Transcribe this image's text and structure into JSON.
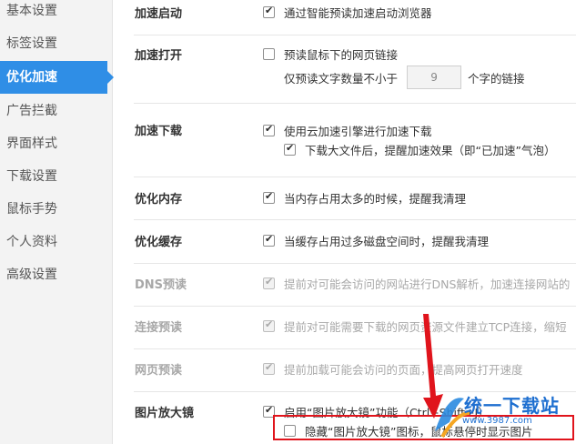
{
  "sidebar": {
    "items": [
      {
        "label": "基本设置",
        "active": false
      },
      {
        "label": "标签设置",
        "active": false
      },
      {
        "label": "优化加速",
        "active": true
      },
      {
        "label": "广告拦截",
        "active": false
      },
      {
        "label": "界面样式",
        "active": false
      },
      {
        "label": "下载设置",
        "active": false
      },
      {
        "label": "鼠标手势",
        "active": false
      },
      {
        "label": "个人资料",
        "active": false
      },
      {
        "label": "高级设置",
        "active": false
      }
    ]
  },
  "sections": {
    "accel_start": {
      "label": "加速启动",
      "option": {
        "text": "通过智能预读加速启动浏览器",
        "checked": true
      }
    },
    "accel_open": {
      "label": "加速打开",
      "option": {
        "text": "预读鼠标下的网页链接",
        "checked": false
      },
      "sub": {
        "prefix": "仅预读文字数量不小于",
        "value": "9",
        "suffix": "个字的链接"
      }
    },
    "accel_download": {
      "label": "加速下载",
      "option": {
        "text": "使用云加速引擎进行加速下载",
        "checked": true
      },
      "sub_option": {
        "text": "下载大文件后，提醒加速效果（即“已加速”气泡）",
        "checked": true
      }
    },
    "optimize_memory": {
      "label": "优化内存",
      "option": {
        "text": "当内存占用太多的时候，提醒我清理",
        "checked": true
      }
    },
    "optimize_cache": {
      "label": "优化缓存",
      "option": {
        "text": "当缓存占用过多磁盘空间时，提醒我清理",
        "checked": true
      }
    },
    "dns_prefetch": {
      "label": "DNS预读",
      "option": {
        "text": "提前对可能会访问的网站进行DNS解析，加速连接网站的",
        "checked": true
      }
    },
    "conn_prefetch": {
      "label": "连接预读",
      "option": {
        "text": "提前对可能需要下载的网页资源文件建立TCP连接，缩短",
        "checked": true
      }
    },
    "page_prefetch": {
      "label": "网页预读",
      "option": {
        "text": "提前加载可能会访问的页面，提高网页打开速度",
        "checked": true
      }
    },
    "magnifier": {
      "label": "图片放大镜",
      "option": {
        "text": "启用“图片放大镜”功能（Ctrl+Shift+J）",
        "checked": true
      },
      "sub_option": {
        "text": "隐藏“图片放大镜”图标，鼠标悬停时显示图片",
        "checked": false
      }
    }
  },
  "watermark": {
    "brand": "统一下载站",
    "url": "www.3987.com"
  },
  "colors": {
    "accent": "#2f8ee6",
    "highlight": "#e0141c",
    "watermark": "#1e6fd0"
  }
}
